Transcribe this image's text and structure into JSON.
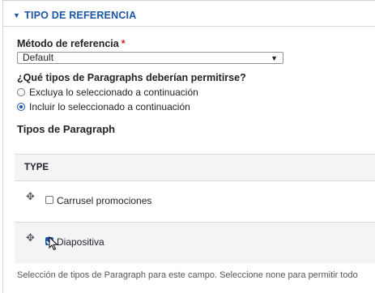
{
  "section": {
    "toggle_glyph": "▼",
    "title": "TIPO DE REFERENCIA"
  },
  "reference_method": {
    "label": "Método de referencia",
    "required_mark": "*",
    "selected": "Default",
    "arrow_glyph": "▼"
  },
  "allowed_types": {
    "question": "¿Qué tipos de Paragraphs deberían permitirse?",
    "options": [
      {
        "label": "Excluya lo seleccionado a continuación",
        "checked": false
      },
      {
        "label": "Incluir lo seleccionado a continuación",
        "checked": true
      }
    ]
  },
  "paragraph_types": {
    "title": "Tipos de Paragraph",
    "column_header": "TYPE",
    "drag_glyph": "✥",
    "rows": [
      {
        "label": "Carrusel promociones",
        "checked": false
      },
      {
        "label": "Diapositiva",
        "checked": true
      }
    ],
    "help_text": "Selección de tipos de Paragraph para este campo. Seleccione none para permitir todo"
  }
}
